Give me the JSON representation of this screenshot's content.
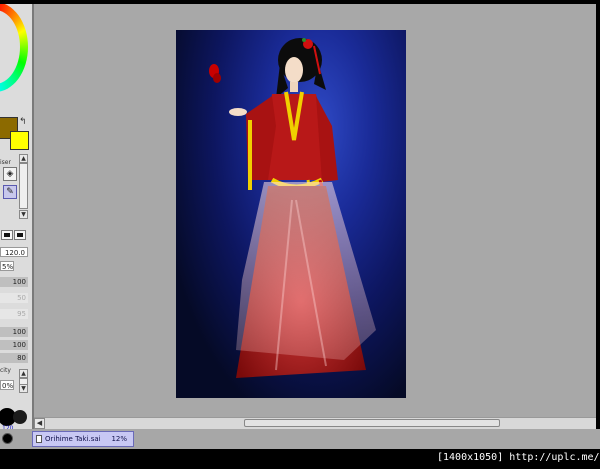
{
  "window": {
    "accent": "#a8a8a8",
    "panel_bg": "#dcdcdc"
  },
  "color_panel": {
    "icon": "color-wheel",
    "main_color": "#8c6a00",
    "sub_color": "#ffff00",
    "swap_icon": "swap-arrow-icon",
    "swap_glyph": "↰"
  },
  "tools": {
    "partial_label": "iser",
    "eraser_glyph": "◈",
    "pen_glyph": "✎",
    "brush_size_partial": "120.0",
    "percent_partial": "5%",
    "values": [
      "100",
      "50",
      "95",
      "100",
      "100",
      "80"
    ],
    "opacity_label_partial": "city",
    "opacity_value_partial": "0%",
    "brush_size_number": "120"
  },
  "document": {
    "tab_name": "Orihime Taki.sai",
    "zoom": "12%"
  },
  "scroll": {
    "left_arrow": "◀",
    "up_arrow": "▲",
    "down_arrow": "▼"
  },
  "watermark": {
    "dimensions": "[1400x1050]",
    "site": "http://uplc.me/"
  }
}
